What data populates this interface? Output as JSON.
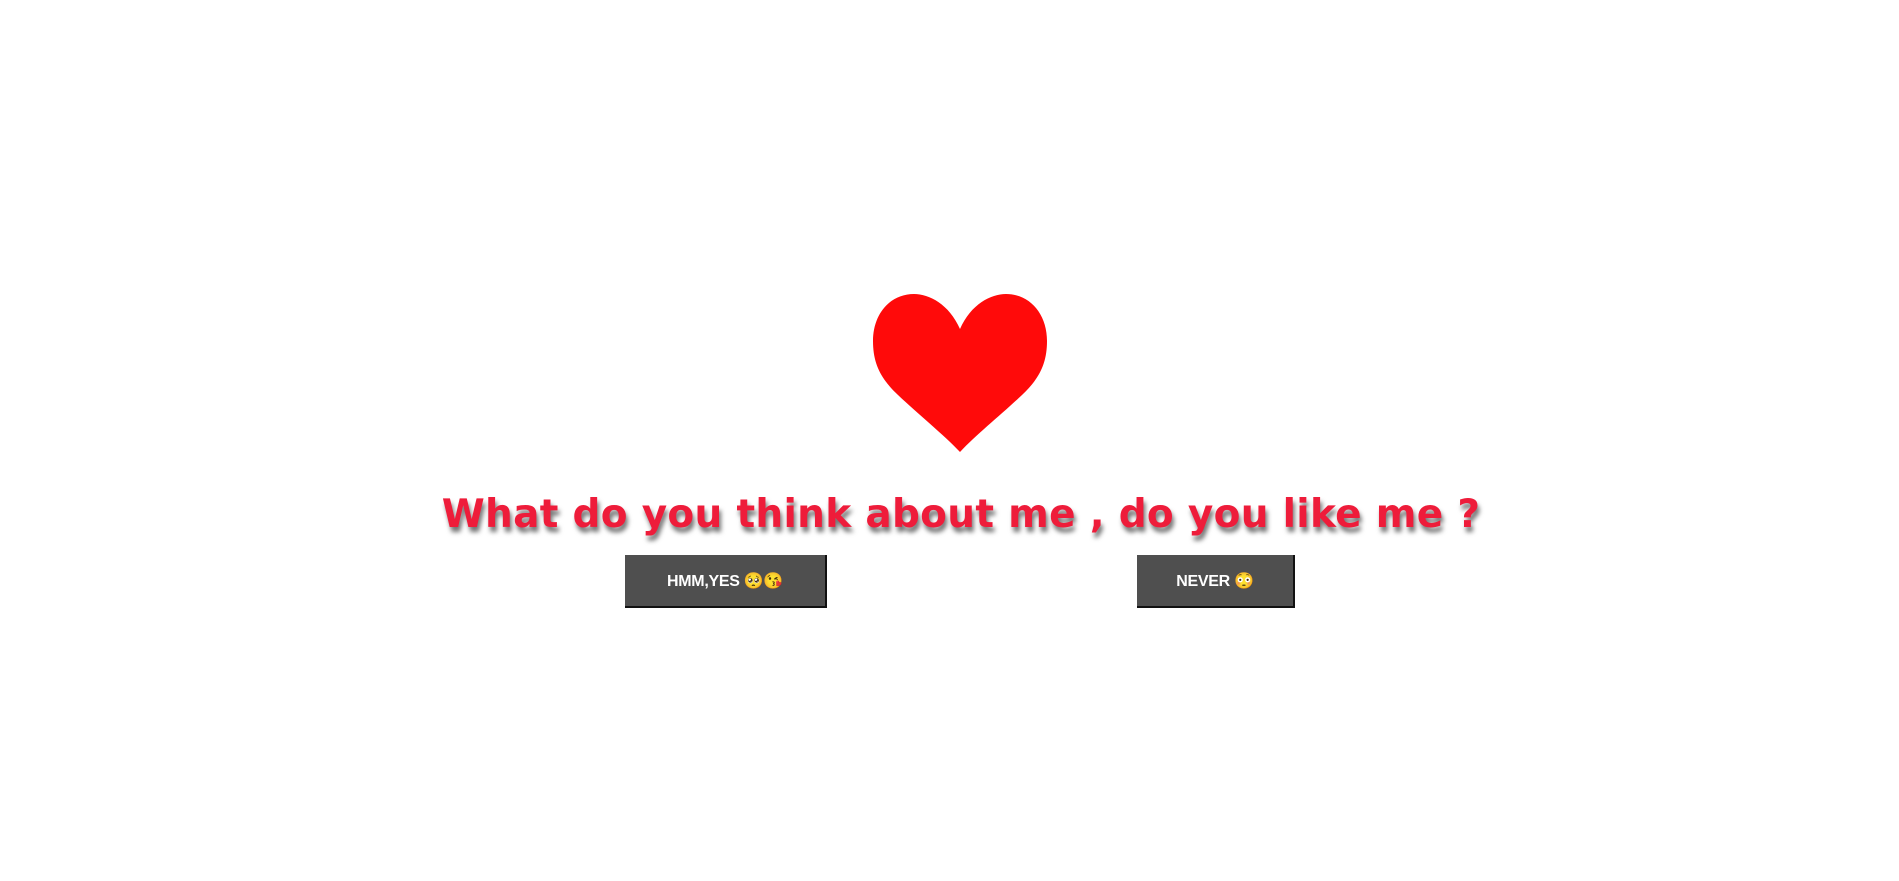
{
  "heart": {
    "icon": "heart-icon",
    "color": "#ff0a0a"
  },
  "question": {
    "text": "What do you think about me , do you like me ?",
    "color": "#ee1c3a"
  },
  "buttons": {
    "yes_label": "HMM,YES 🥺😘",
    "no_label": "NEVER 😳",
    "background": "#4f4f4f",
    "text_color": "#ffffff"
  }
}
